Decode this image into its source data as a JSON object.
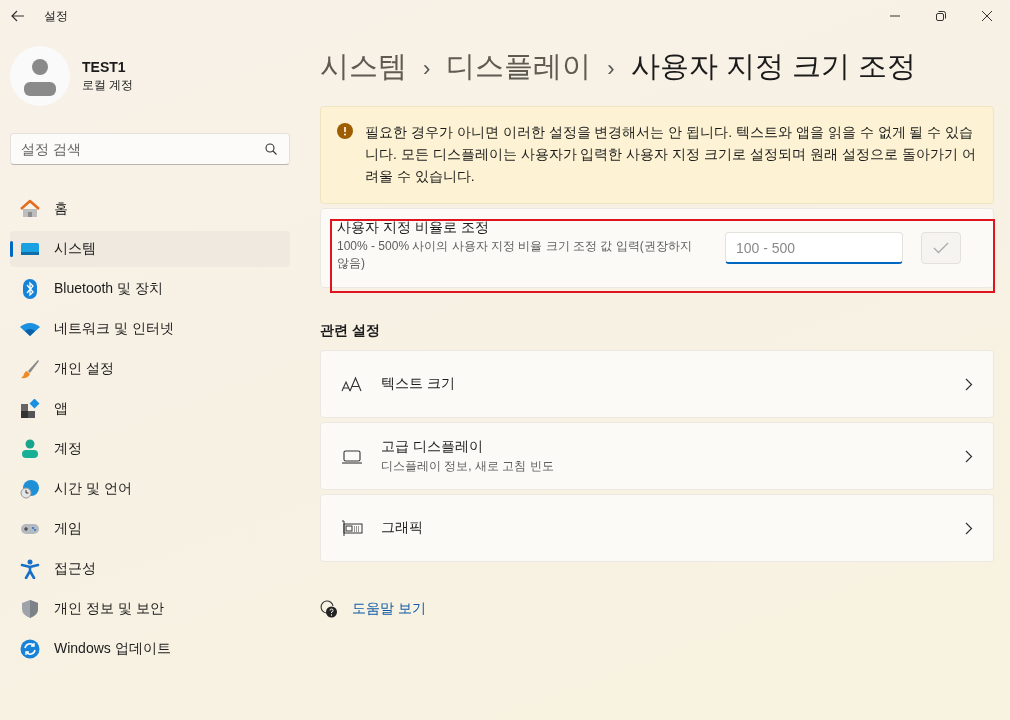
{
  "window": {
    "title": "설정"
  },
  "account": {
    "name": "TEST1",
    "type": "로컬 계정"
  },
  "search": {
    "placeholder": "설정 검색"
  },
  "nav": [
    {
      "kind": "home",
      "label": "홈",
      "selected": false
    },
    {
      "kind": "system",
      "label": "시스템",
      "selected": true
    },
    {
      "kind": "bluetooth",
      "label": "Bluetooth 및 장치",
      "selected": false
    },
    {
      "kind": "network",
      "label": "네트워크 및 인터넷",
      "selected": false
    },
    {
      "kind": "personalization",
      "label": "개인 설정",
      "selected": false
    },
    {
      "kind": "apps",
      "label": "앱",
      "selected": false
    },
    {
      "kind": "accounts",
      "label": "계정",
      "selected": false
    },
    {
      "kind": "time",
      "label": "시간 및 언어",
      "selected": false
    },
    {
      "kind": "gaming",
      "label": "게임",
      "selected": false
    },
    {
      "kind": "accessibility",
      "label": "접근성",
      "selected": false
    },
    {
      "kind": "privacy",
      "label": "개인 정보 및 보안",
      "selected": false
    },
    {
      "kind": "update",
      "label": "Windows 업데이트",
      "selected": false
    }
  ],
  "breadcrumb": [
    {
      "label": "시스템",
      "separator": "›",
      "current": false
    },
    {
      "label": "디스플레이",
      "separator": "›",
      "current": false
    },
    {
      "label": "사용자 지정 크기 조정",
      "current": true
    }
  ],
  "warning": {
    "text": "필요한 경우가 아니면 이러한 설정을 변경해서는 안 됩니다. 텍스트와 앱을 읽을 수 없게 될 수 있습니다. 모든 디스플레이는 사용자가 입력한 사용자 지정 크기로 설정되며 원래 설정으로 돌아가기 어려울 수 있습니다."
  },
  "custom_scale": {
    "title": "사용자 지정 비율로 조정",
    "description": "100% - 500% 사이의 사용자 지정 비율 크기 조정 값 입력(권장하지 않음)",
    "placeholder": "100 - 500",
    "highlighted": true,
    "apply_disabled": true
  },
  "related": {
    "heading": "관련 설정",
    "items": [
      {
        "kind": "text",
        "title": "텍스트 크기"
      },
      {
        "kind": "display",
        "title": "고급 디스플레이",
        "subtitle": "디스플레이 정보, 새로 고침 빈도"
      },
      {
        "kind": "graphics",
        "title": "그래픽"
      }
    ]
  },
  "help": {
    "label": "도움말 보기"
  }
}
